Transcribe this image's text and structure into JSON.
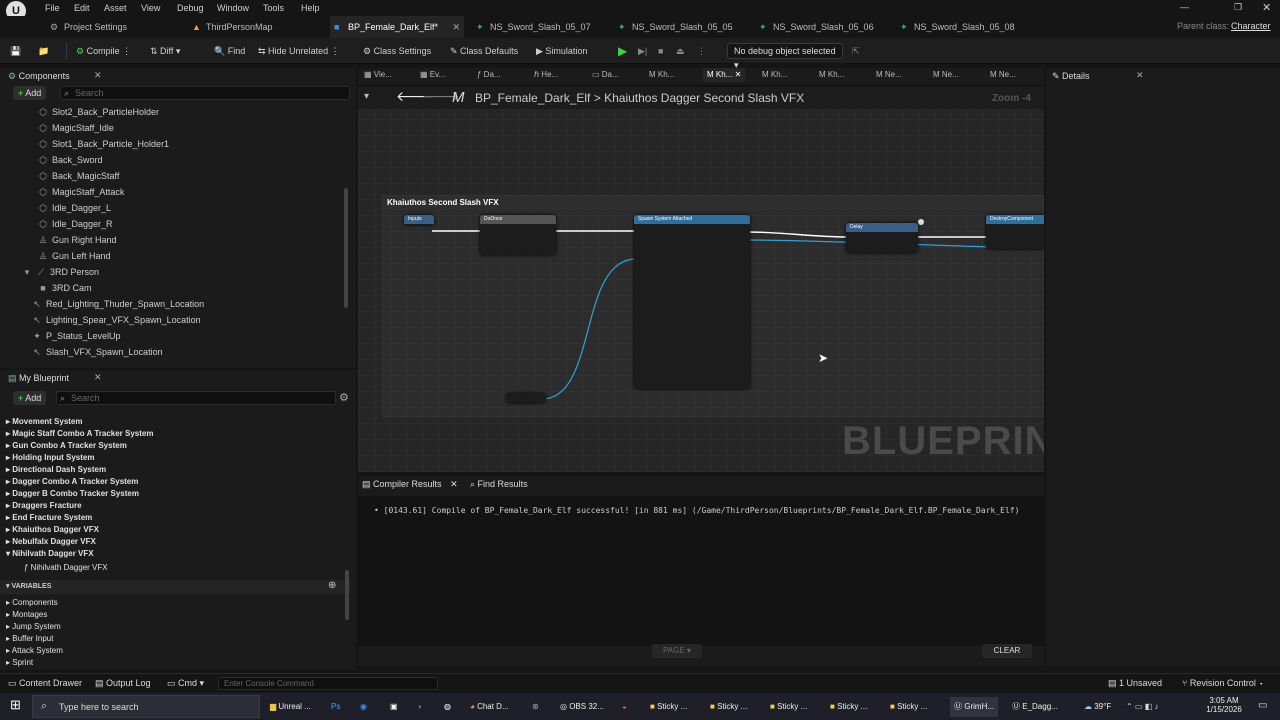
{
  "menu": [
    "File",
    "Edit",
    "Asset",
    "View",
    "Debug",
    "Window",
    "Tools",
    "Help"
  ],
  "tabs": [
    {
      "label": "Project Settings",
      "icon": "⚙"
    },
    {
      "label": "ThirdPersonMap",
      "icon": "▲"
    },
    {
      "label": "BP_Female_Dark_Elf*",
      "icon": "■"
    },
    {
      "label": "NS_Sword_Slash_05_07",
      "icon": "✦"
    },
    {
      "label": "NS_Sword_Slash_05_05",
      "icon": "✦"
    },
    {
      "label": "NS_Sword_Slash_05_06",
      "icon": "✦"
    },
    {
      "label": "NS_Sword_Slash_05_08",
      "icon": "✦"
    }
  ],
  "parent_class": {
    "label": "Parent class:",
    "value": "Character"
  },
  "toolbar": {
    "compile": "Compile",
    "diff": "Diff",
    "find": "Find",
    "hide_unrelated": "Hide Unrelated",
    "class_settings": "Class Settings",
    "class_defaults": "Class Defaults",
    "simulation": "Simulation",
    "debug_object": "No debug object selected"
  },
  "components": {
    "title": "Components",
    "add": "Add",
    "search_placeholder": "Search",
    "items": [
      "Slot2_Back_ParticleHolder",
      "MagicStaff_Idle",
      "Slot1_Back_Particle_Holder1",
      "Back_Sword",
      "Back_MagicStaff",
      "MagicStaff_Attack",
      "Idle_Dagger_L",
      "Idle_Dagger_R",
      "Gun Right Hand",
      "Gun Left Hand",
      "3RD Person",
      "3RD Cam",
      "Red_Lighting_Thuder_Spawn_Location",
      "Lighting_Spear_VFX_Spawn_Location",
      "P_Status_LevelUp",
      "Slash_VFX_Spawn_Location"
    ]
  },
  "my_blueprint": {
    "title": "My Blueprint",
    "add": "Add",
    "search_placeholder": "Search",
    "graphs": [
      "Movement System",
      "Magic Staff Combo A Tracker System",
      "Gun Combo A Tracker System",
      "Holding Input System",
      "Directional Dash System",
      "Dagger Combo A Tracker System",
      "Dagger B Combo Tracker System",
      "Draggers Fracture",
      "End Fracture System",
      "Khaiuthos Dagger VFX",
      "Nebulfalx Dagger VFX",
      "Nihilvath Dagger VFX",
      "Nihilvath Dagger VFX"
    ],
    "variables_header": "VARIABLES",
    "variables": [
      "Components",
      "Montages",
      "Jump System",
      "Buffer Input",
      "Attack System",
      "Sprint"
    ]
  },
  "graph_tabs": [
    "Vie...",
    "Ev...",
    "Da...",
    "He...",
    "Da...",
    "Kh...",
    "Kh...",
    "Kh...",
    "Kh...",
    "Ne...",
    "Ne...",
    "Ne..."
  ],
  "breadcrumb": {
    "root": "BP_Female_Dark_Elf",
    "separator": ">",
    "current": "Khaiuthos Dagger  Second Slash VFX"
  },
  "zoom": "Zoom -4",
  "comment_title": "Khaiuthos Second Slash VFX",
  "watermark": "BLUEPRINT",
  "bottom": {
    "tab_compiler": "Compiler Results",
    "tab_find": "Find Results",
    "message": "[0143.61] Compile of BP_Female_Dark_Elf successful! [in 881 ms] (/Game/ThirdPerson/Blueprints/BP_Female_Dark_Elf.BP_Female_Dark_Elf)",
    "page": "PAGE",
    "clear": "CLEAR"
  },
  "details_title": "Details",
  "status": {
    "content_drawer": "Content Drawer",
    "output_log": "Output Log",
    "cmd": "Cmd",
    "console_placeholder": "Enter Console Command",
    "unsaved": "1 Unsaved",
    "revision": "Revision Control"
  },
  "taskbar": {
    "search": "Type here to search",
    "apps": [
      "Unreal ...",
      "Chat D...",
      "OBS 32...",
      "Sticky ...",
      "Sticky ...",
      "Sticky ...",
      "Sticky ...",
      "Sticky ...",
      "GrimH...",
      "E_Dagg..."
    ],
    "weather": "39°F",
    "time": "3:05 AM",
    "date": "1/15/2026"
  }
}
